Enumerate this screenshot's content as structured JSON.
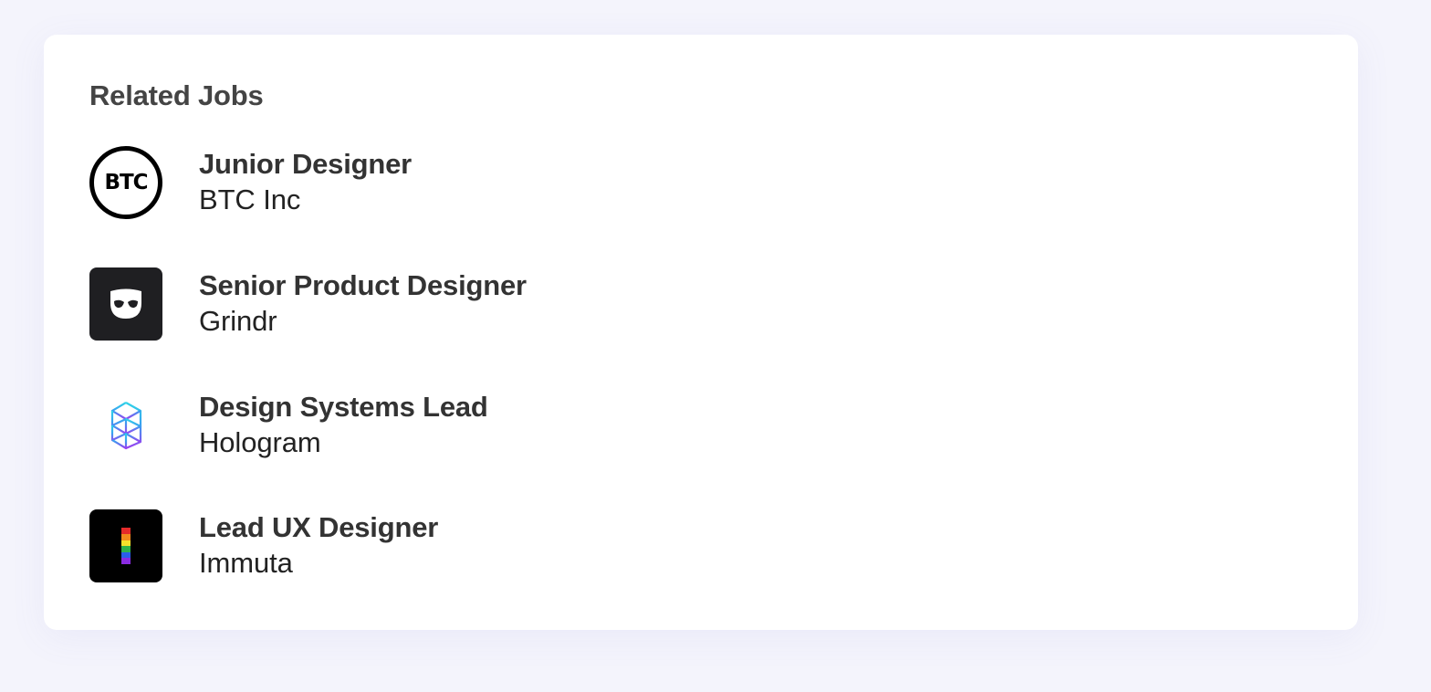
{
  "related_jobs": {
    "heading": "Related Jobs",
    "items": [
      {
        "title": "Junior Designer",
        "company": "BTC Inc",
        "logo_icon": "btc-logo-icon",
        "logo_text": "BTC"
      },
      {
        "title": "Senior Product Designer",
        "company": "Grindr",
        "logo_icon": "grindr-mask-icon"
      },
      {
        "title": "Design Systems Lead",
        "company": "Hologram",
        "logo_icon": "hologram-logo-icon"
      },
      {
        "title": "Lead UX Designer",
        "company": "Immuta",
        "logo_icon": "immuta-rainbow-bar-icon"
      }
    ]
  },
  "colors": {
    "page_background": "#f4f4fc",
    "card_background": "#ffffff",
    "heading": "#444444",
    "job_title": "#333333",
    "company": "#222222",
    "grindr_bg": "#1f1f22",
    "immuta_bg": "#000000"
  }
}
